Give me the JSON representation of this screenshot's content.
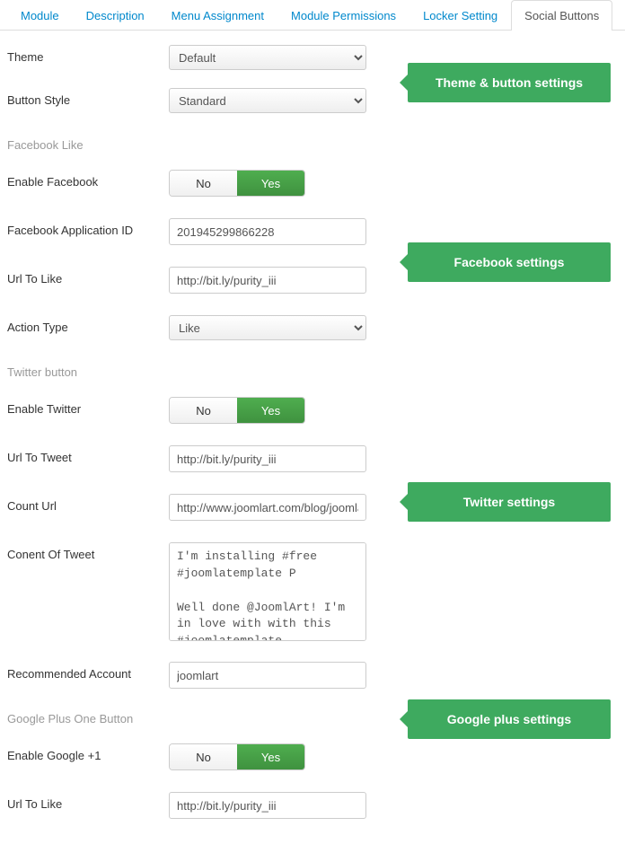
{
  "tabs": {
    "t0": "Module",
    "t1": "Description",
    "t2": "Menu Assignment",
    "t3": "Module Permissions",
    "t4": "Locker Setting",
    "t5": "Social Buttons"
  },
  "callouts": {
    "theme": "Theme & button settings",
    "facebook": "Facebook settings",
    "twitter": "Twitter settings",
    "google": "Google plus settings"
  },
  "labels": {
    "theme": "Theme",
    "button_style": "Button Style",
    "section_fb": "Facebook Like",
    "enable_fb": "Enable Facebook",
    "fb_app_id": "Facebook Application ID",
    "url_to_like": "Url To Like",
    "action_type": "Action Type",
    "section_tw": "Twitter button",
    "enable_tw": "Enable Twitter",
    "url_to_tweet": "Url To Tweet",
    "count_url": "Count Url",
    "content_tweet": "Conent Of Tweet",
    "rec_account": "Recommended Account",
    "section_gp": "Google Plus One Button",
    "enable_gp": "Enable Google +1",
    "url_to_like_gp": "Url To Like"
  },
  "options": {
    "no": "No",
    "yes": "Yes"
  },
  "values": {
    "theme": "Default",
    "button_style": "Standard",
    "fb_app_id": "201945299866228",
    "url_to_like": "http://bit.ly/purity_iii",
    "action_type": "Like",
    "url_to_tweet": "http://bit.ly/purity_iii",
    "count_url": "http://www.joomlart.com/blog/joomla-",
    "content_tweet": "I'm installing #free #joomlatemplate P\n\nWell done @JoomlArt! I'm in love with with this #joomlatemplate",
    "rec_account": "joomlart",
    "url_to_like_gp": "http://bit.ly/purity_iii"
  }
}
